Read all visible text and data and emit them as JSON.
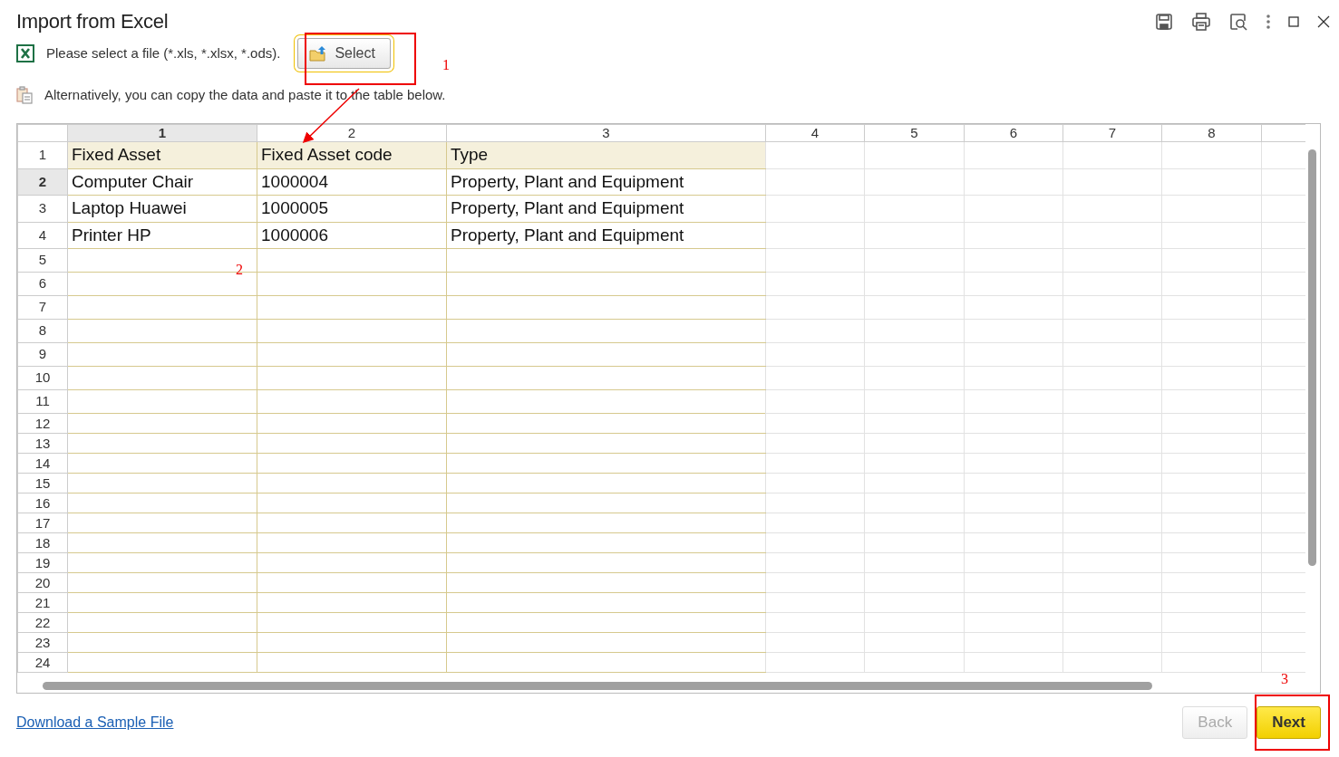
{
  "window": {
    "title": "Import from Excel"
  },
  "file_prompt": {
    "text": "Please select a file (*.xls, *.xlsx, *.ods).",
    "button": "Select"
  },
  "paste_hint": "Alternatively, you can copy the data and paste it to the table below.",
  "sheet": {
    "columns": [
      {
        "label": "1",
        "selected": true
      },
      {
        "label": "2",
        "selected": false
      },
      {
        "label": "3",
        "selected": false
      },
      {
        "label": "4",
        "selected": false
      },
      {
        "label": "5",
        "selected": false
      },
      {
        "label": "6",
        "selected": false
      },
      {
        "label": "7",
        "selected": false
      },
      {
        "label": "8",
        "selected": false
      }
    ],
    "rows": [
      {
        "number": "1",
        "selected": false,
        "kind": "header",
        "cells": [
          "Fixed Asset",
          "Fixed Asset code",
          "Type"
        ]
      },
      {
        "number": "2",
        "selected": true,
        "kind": "data",
        "cells": [
          "Computer Chair",
          "1000004",
          "Property, Plant and Equipment"
        ]
      },
      {
        "number": "3",
        "selected": false,
        "kind": "data",
        "cells": [
          "Laptop Huawei",
          "1000005",
          "Property, Plant and Equipment"
        ]
      },
      {
        "number": "4",
        "selected": false,
        "kind": "data",
        "cells": [
          "Printer HP",
          "1000006",
          "Property, Plant and Equipment"
        ]
      },
      {
        "number": "5",
        "selected": false,
        "kind": "data",
        "cells": []
      },
      {
        "number": "6",
        "selected": false,
        "kind": "data",
        "cells": []
      },
      {
        "number": "7",
        "selected": false,
        "kind": "data",
        "cells": []
      },
      {
        "number": "8",
        "selected": false,
        "kind": "data",
        "cells": []
      },
      {
        "number": "9",
        "selected": false,
        "kind": "data",
        "cells": []
      },
      {
        "number": "10",
        "selected": false,
        "kind": "data",
        "cells": []
      },
      {
        "number": "11",
        "selected": false,
        "kind": "data",
        "cells": []
      },
      {
        "number": "12",
        "selected": false,
        "kind": "data",
        "cells": []
      },
      {
        "number": "13",
        "selected": false,
        "kind": "data",
        "cells": []
      },
      {
        "number": "14",
        "selected": false,
        "kind": "data",
        "cells": []
      },
      {
        "number": "15",
        "selected": false,
        "kind": "data",
        "cells": []
      },
      {
        "number": "16",
        "selected": false,
        "kind": "data",
        "cells": []
      },
      {
        "number": "17",
        "selected": false,
        "kind": "data",
        "cells": []
      },
      {
        "number": "18",
        "selected": false,
        "kind": "data",
        "cells": []
      },
      {
        "number": "19",
        "selected": false,
        "kind": "data",
        "cells": []
      },
      {
        "number": "20",
        "selected": false,
        "kind": "data",
        "cells": []
      },
      {
        "number": "21",
        "selected": false,
        "kind": "data",
        "cells": []
      },
      {
        "number": "22",
        "selected": false,
        "kind": "data",
        "cells": []
      },
      {
        "number": "23",
        "selected": false,
        "kind": "data",
        "cells": []
      },
      {
        "number": "24",
        "selected": false,
        "kind": "data",
        "cells": []
      }
    ]
  },
  "sample_link": "Download a Sample File",
  "buttons": [
    {
      "label": "Back",
      "disabled": true
    },
    {
      "label": "Next",
      "disabled": false
    }
  ],
  "annotations": [
    "1",
    "2",
    "3"
  ]
}
